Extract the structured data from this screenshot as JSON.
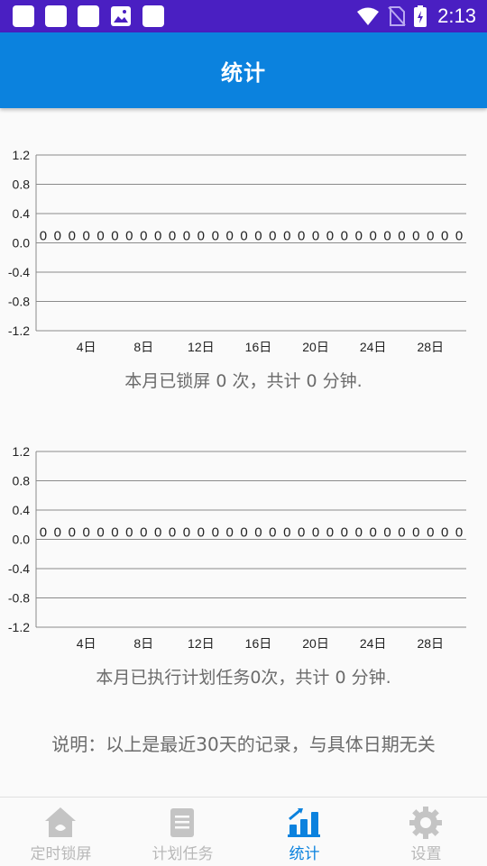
{
  "statusbar": {
    "time": "2:13"
  },
  "appbar": {
    "title": "统计"
  },
  "charts": [
    {
      "y_ticks": [
        "1.2",
        "0.8",
        "0.4",
        "0.0",
        "-0.4",
        "-0.8",
        "-1.2"
      ],
      "x_ticks": [
        "4日",
        "8日",
        "12日",
        "16日",
        "20日",
        "24日",
        "28日"
      ],
      "caption": "本月已锁屏 0 次，共计 0 分钟."
    },
    {
      "y_ticks": [
        "1.2",
        "0.8",
        "0.4",
        "0.0",
        "-0.4",
        "-0.8",
        "-1.2"
      ],
      "x_ticks": [
        "4日",
        "8日",
        "12日",
        "16日",
        "20日",
        "24日",
        "28日"
      ],
      "caption": "本月已执行计划任务0次，共计 0 分钟."
    }
  ],
  "chart_data": [
    {
      "type": "line",
      "x": [
        1,
        2,
        3,
        4,
        5,
        6,
        7,
        8,
        9,
        10,
        11,
        12,
        13,
        14,
        15,
        16,
        17,
        18,
        19,
        20,
        21,
        22,
        23,
        24,
        25,
        26,
        27,
        28,
        29,
        30
      ],
      "values": [
        0,
        0,
        0,
        0,
        0,
        0,
        0,
        0,
        0,
        0,
        0,
        0,
        0,
        0,
        0,
        0,
        0,
        0,
        0,
        0,
        0,
        0,
        0,
        0,
        0,
        0,
        0,
        0,
        0,
        0
      ],
      "ylim": [
        -1.2,
        1.2
      ],
      "xlabel": "",
      "ylabel": "",
      "title": "",
      "grid": true
    },
    {
      "type": "line",
      "x": [
        1,
        2,
        3,
        4,
        5,
        6,
        7,
        8,
        9,
        10,
        11,
        12,
        13,
        14,
        15,
        16,
        17,
        18,
        19,
        20,
        21,
        22,
        23,
        24,
        25,
        26,
        27,
        28,
        29,
        30
      ],
      "values": [
        0,
        0,
        0,
        0,
        0,
        0,
        0,
        0,
        0,
        0,
        0,
        0,
        0,
        0,
        0,
        0,
        0,
        0,
        0,
        0,
        0,
        0,
        0,
        0,
        0,
        0,
        0,
        0,
        0,
        0
      ],
      "ylim": [
        -1.2,
        1.2
      ],
      "xlabel": "",
      "ylabel": "",
      "title": "",
      "grid": true
    }
  ],
  "note": "说明：以上是最近30天的记录，与具体日期无关",
  "nav": {
    "items": [
      {
        "label": "定时锁屏",
        "icon": "home-lock-icon"
      },
      {
        "label": "计划任务",
        "icon": "document-icon"
      },
      {
        "label": "统计",
        "icon": "bar-chart-icon"
      },
      {
        "label": "设置",
        "icon": "gear-icon"
      }
    ],
    "active_index": 2
  },
  "colors": {
    "status_bar": "#4a1fc2",
    "app_bar": "#0b82de",
    "accent": "#0b82de",
    "inactive": "#b8b8b8"
  }
}
